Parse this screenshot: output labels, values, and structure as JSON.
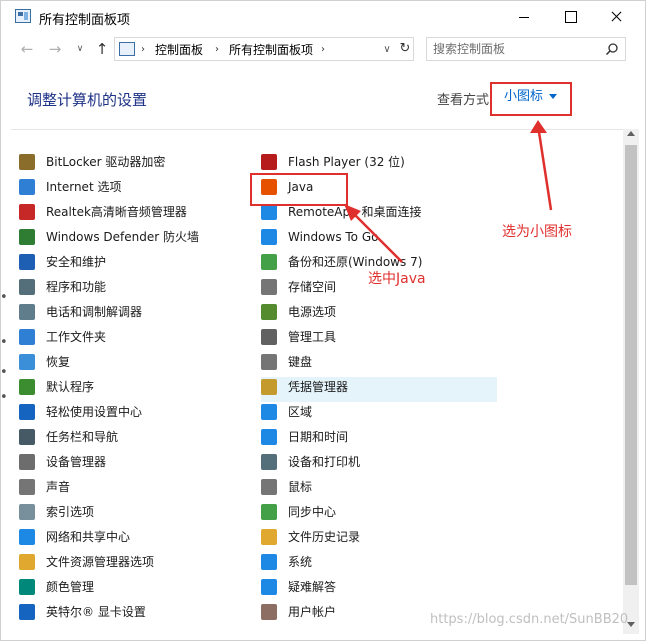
{
  "window": {
    "title": "所有控制面板项"
  },
  "address_bar": {
    "crumbs": [
      "控制面板",
      "所有控制面板项"
    ],
    "search_placeholder": "搜索控制面板"
  },
  "header": {
    "title": "调整计算机的设置",
    "view_label": "查看方式",
    "view_value": "小图标"
  },
  "items_left": [
    {
      "label": "BitLocker 驱动器加密",
      "icon": "bitlocker-icon",
      "color": "#8a6d2b"
    },
    {
      "label": "Internet 选项",
      "icon": "internet-options-icon",
      "color": "#2f7fd4"
    },
    {
      "label": "Realtek高清晰音频管理器",
      "icon": "realtek-audio-icon",
      "color": "#c62828"
    },
    {
      "label": "Windows Defender 防火墙",
      "icon": "firewall-icon",
      "color": "#2e7d32"
    },
    {
      "label": "安全和维护",
      "icon": "security-flag-icon",
      "color": "#1e5fb4"
    },
    {
      "label": "程序和功能",
      "icon": "programs-icon",
      "color": "#546e7a"
    },
    {
      "label": "电话和调制解调器",
      "icon": "phone-modem-icon",
      "color": "#607d8b"
    },
    {
      "label": "工作文件夹",
      "icon": "work-folders-icon",
      "color": "#2f7fd4"
    },
    {
      "label": "恢复",
      "icon": "recovery-icon",
      "color": "#3b8ed8"
    },
    {
      "label": "默认程序",
      "icon": "default-programs-icon",
      "color": "#3c8d2f"
    },
    {
      "label": "轻松使用设置中心",
      "icon": "ease-of-access-icon",
      "color": "#1565c0"
    },
    {
      "label": "任务栏和导航",
      "icon": "taskbar-icon",
      "color": "#455a64"
    },
    {
      "label": "设备管理器",
      "icon": "device-manager-icon",
      "color": "#6d6d6d"
    },
    {
      "label": "声音",
      "icon": "sound-icon",
      "color": "#757575"
    },
    {
      "label": "索引选项",
      "icon": "indexing-icon",
      "color": "#78909c"
    },
    {
      "label": "网络和共享中心",
      "icon": "network-icon",
      "color": "#1e88e5"
    },
    {
      "label": "文件资源管理器选项",
      "icon": "explorer-options-icon",
      "color": "#e0a82e"
    },
    {
      "label": "颜色管理",
      "icon": "color-management-icon",
      "color": "#00897b"
    },
    {
      "label": "英特尔® 显卡设置",
      "icon": "intel-graphics-icon",
      "color": "#1565c0"
    }
  ],
  "items_right": [
    {
      "label": "Flash Player (32 位)",
      "icon": "flash-player-icon",
      "color": "#b71c1c"
    },
    {
      "label": "Java",
      "icon": "java-icon",
      "color": "#e65100"
    },
    {
      "label": "RemoteApp 和桌面连接",
      "icon": "remoteapp-icon",
      "color": "#1e88e5"
    },
    {
      "label": "Windows To Go",
      "icon": "windows-to-go-icon",
      "color": "#1e88e5"
    },
    {
      "label": "备份和还原(Windows 7)",
      "icon": "backup-restore-icon",
      "color": "#43a047"
    },
    {
      "label": "存储空间",
      "icon": "storage-spaces-icon",
      "color": "#757575"
    },
    {
      "label": "电源选项",
      "icon": "power-options-icon",
      "color": "#558b2f"
    },
    {
      "label": "管理工具",
      "icon": "admin-tools-icon",
      "color": "#616161"
    },
    {
      "label": "键盘",
      "icon": "keyboard-icon",
      "color": "#757575"
    },
    {
      "label": "凭据管理器",
      "icon": "credential-manager-icon",
      "color": "#c49a2c"
    },
    {
      "label": "区域",
      "icon": "region-icon",
      "color": "#1e88e5"
    },
    {
      "label": "日期和时间",
      "icon": "date-time-icon",
      "color": "#1e88e5"
    },
    {
      "label": "设备和打印机",
      "icon": "devices-printers-icon",
      "color": "#546e7a"
    },
    {
      "label": "鼠标",
      "icon": "mouse-icon",
      "color": "#757575"
    },
    {
      "label": "同步中心",
      "icon": "sync-center-icon",
      "color": "#43a047"
    },
    {
      "label": "文件历史记录",
      "icon": "file-history-icon",
      "color": "#e0a82e"
    },
    {
      "label": "系统",
      "icon": "system-icon",
      "color": "#1e88e5"
    },
    {
      "label": "疑难解答",
      "icon": "troubleshooting-icon",
      "color": "#1e88e5"
    },
    {
      "label": "用户帐户",
      "icon": "user-accounts-icon",
      "color": "#8d6e63"
    }
  ],
  "annotations": {
    "select_small_icons": "选为小图标",
    "select_java": "选中Java",
    "color": "#e0302e"
  },
  "watermark": "https://blog.csdn.net/SunBB20"
}
